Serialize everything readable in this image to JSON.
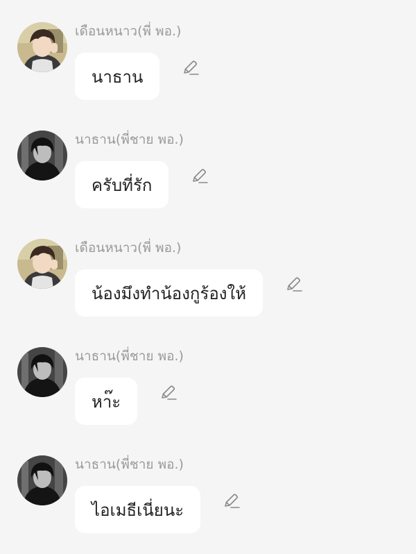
{
  "colors": {
    "background": "#f5f5f5",
    "bubble": "#ffffff",
    "sender_name": "#9a9a9a",
    "message_text": "#222222",
    "edit_icon": "#8a8a8a"
  },
  "messages": [
    {
      "sender": "เดือนหนาว(พี่ พอ.)",
      "avatar": "dueannao-avatar",
      "text": "นาธาน",
      "icon": "pencil-icon"
    },
    {
      "sender": "นาธาน(พี่ชาย พอ.)",
      "avatar": "nathan-avatar",
      "text": "ครับที่รัก",
      "icon": "pencil-icon"
    },
    {
      "sender": "เดือนหนาว(พี่ พอ.)",
      "avatar": "dueannao-avatar",
      "text": "น้องมึงทำน้องกูร้องให้",
      "icon": "pencil-icon"
    },
    {
      "sender": "นาธาน(พี่ชาย พอ.)",
      "avatar": "nathan-avatar",
      "text": "หา๊ะ",
      "icon": "pencil-icon"
    },
    {
      "sender": "นาธาน(พี่ชาย พอ.)",
      "avatar": "nathan-avatar",
      "text": "ไอเมธีเนี่ยนะ",
      "icon": "pencil-icon"
    }
  ]
}
